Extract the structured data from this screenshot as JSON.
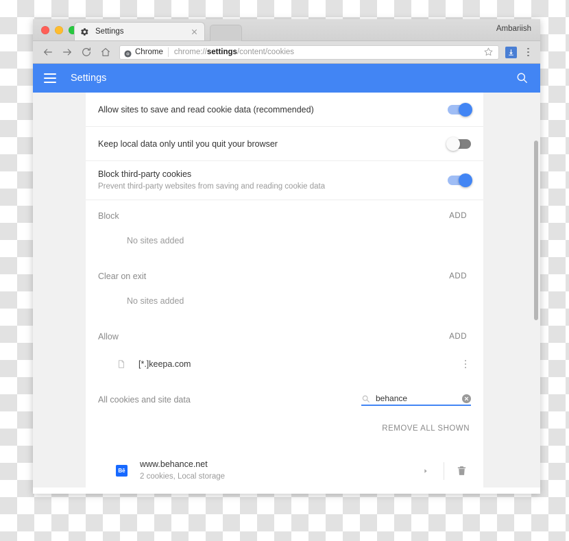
{
  "window": {
    "traffic_lights": [
      "close",
      "minimize",
      "maximize"
    ],
    "profile_name": "Ambariish"
  },
  "tab": {
    "icon": "gear-icon",
    "title": "Settings",
    "close_label": "×"
  },
  "toolbar": {
    "back_icon": "back-arrow-icon",
    "forward_icon": "forward-arrow-icon",
    "reload_icon": "reload-icon",
    "home_icon": "home-icon",
    "chrome_chip_label": "Chrome",
    "chrome_chip_icon": "chrome-logo-icon",
    "url_prefix": "chrome://",
    "url_bold": "settings",
    "url_suffix": "/content/cookies",
    "url_full": "chrome://settings/content/cookies",
    "star_icon": "star-bookmark-icon",
    "download_icon": "download-icon",
    "menu_icon": "three-dot-menu-icon"
  },
  "settings_header": {
    "menu_icon": "hamburger-menu-icon",
    "title": "Settings",
    "search_icon": "search-icon",
    "accent_color": "#4285f4"
  },
  "content": {
    "toggles": [
      {
        "title": "Allow sites to save and read cookie data (recommended)",
        "subtitle": "",
        "state": "on"
      },
      {
        "title": "Keep local data only until you quit your browser",
        "subtitle": "",
        "state": "off"
      },
      {
        "title": "Block third-party cookies",
        "subtitle": "Prevent third-party websites from saving and reading cookie data",
        "state": "on"
      }
    ],
    "sections": [
      {
        "title": "Block",
        "add_label": "ADD",
        "empty_text": "No sites added"
      },
      {
        "title": "Clear on exit",
        "add_label": "ADD",
        "empty_text": "No sites added"
      }
    ],
    "allow_section": {
      "title": "Allow",
      "add_label": "ADD",
      "entries": [
        {
          "icon": "page-document-icon",
          "name": "[*.]keepa.com",
          "menu_icon": "three-dot-menu-icon"
        }
      ]
    },
    "all_cookies": {
      "title": "All cookies and site data",
      "search": {
        "icon": "search-icon",
        "value": "behance",
        "placeholder": "Search",
        "clear_icon": "clear-circle-icon",
        "underline_color": "#4285f4"
      },
      "remove_all_label": "REMOVE ALL SHOWN",
      "entries": [
        {
          "favicon_text": "Bē",
          "favicon_color": "#1769ff",
          "site": "www.behance.net",
          "meta": "2 cookies, Local storage",
          "expand_icon": "chevron-right-icon",
          "delete_icon": "trash-icon"
        }
      ]
    }
  }
}
